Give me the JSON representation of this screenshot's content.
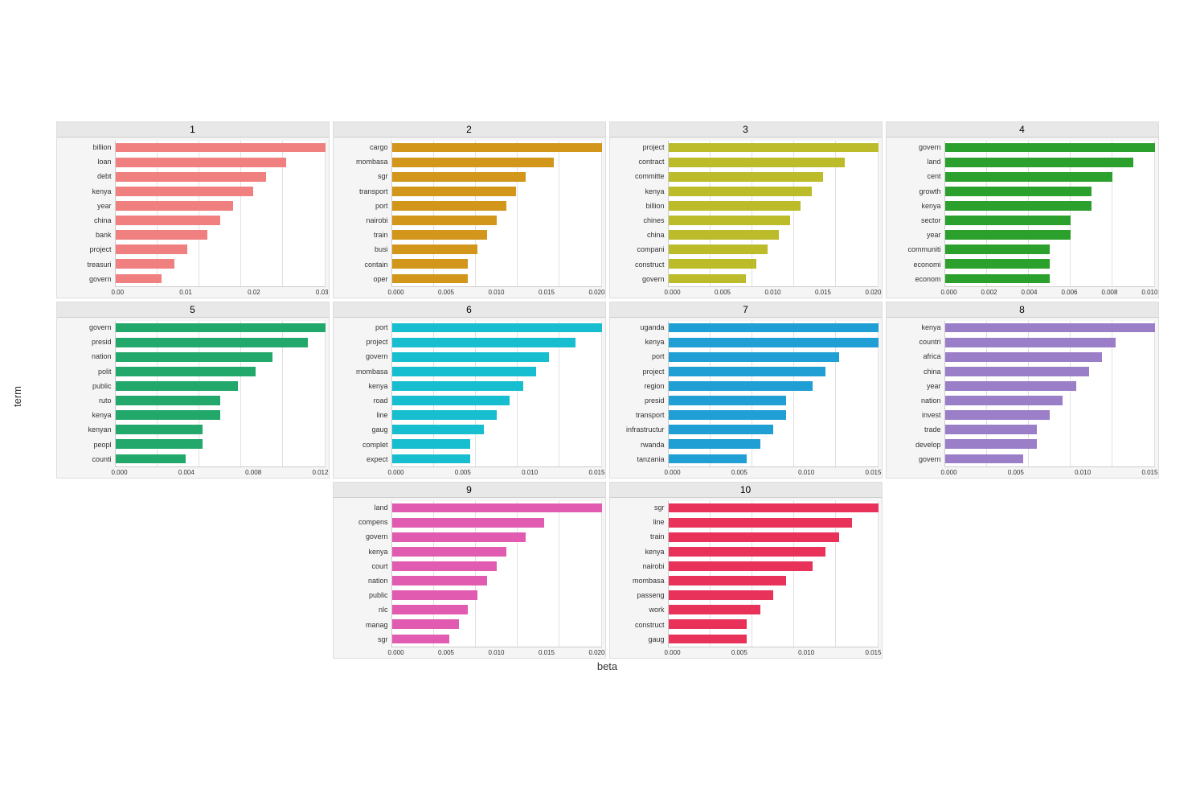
{
  "yAxisLabel": "term",
  "xAxisLabel": "beta",
  "panels": [
    {
      "id": 1,
      "color": "#F08080",
      "maxBeta": 0.03,
      "xLabels": "0.00 0.01 0.02 0.03",
      "terms": [
        {
          "label": "billion",
          "value": 0.032
        },
        {
          "label": "loan",
          "value": 0.026
        },
        {
          "label": "debt",
          "value": 0.023
        },
        {
          "label": "kenya",
          "value": 0.021
        },
        {
          "label": "year",
          "value": 0.018
        },
        {
          "label": "china",
          "value": 0.016
        },
        {
          "label": "bank",
          "value": 0.014
        },
        {
          "label": "project",
          "value": 0.011
        },
        {
          "label": "treasuri",
          "value": 0.009
        },
        {
          "label": "govern",
          "value": 0.007
        }
      ]
    },
    {
      "id": 2,
      "color": "#D2961A",
      "maxBeta": 0.02,
      "xLabels": "0.000 0.005 0.010 0.015 0.020",
      "terms": [
        {
          "label": "cargo",
          "value": 0.022
        },
        {
          "label": "mombasa",
          "value": 0.017
        },
        {
          "label": "sgr",
          "value": 0.014
        },
        {
          "label": "transport",
          "value": 0.013
        },
        {
          "label": "port",
          "value": 0.012
        },
        {
          "label": "nairobi",
          "value": 0.011
        },
        {
          "label": "train",
          "value": 0.01
        },
        {
          "label": "busi",
          "value": 0.009
        },
        {
          "label": "contain",
          "value": 0.008
        },
        {
          "label": "oper",
          "value": 0.008
        }
      ]
    },
    {
      "id": 3,
      "color": "#BCBC2A",
      "maxBeta": 0.02,
      "xLabels": "0.000 0.005 0.010 0.015 0.020",
      "terms": [
        {
          "label": "project",
          "value": 0.019
        },
        {
          "label": "contract",
          "value": 0.016
        },
        {
          "label": "committe",
          "value": 0.014
        },
        {
          "label": "kenya",
          "value": 0.013
        },
        {
          "label": "billion",
          "value": 0.012
        },
        {
          "label": "chines",
          "value": 0.011
        },
        {
          "label": "china",
          "value": 0.01
        },
        {
          "label": "compani",
          "value": 0.009
        },
        {
          "label": "construct",
          "value": 0.008
        },
        {
          "label": "govern",
          "value": 0.007
        }
      ]
    },
    {
      "id": 4,
      "color": "#2CA02C",
      "maxBeta": 0.01,
      "xLabels": "0.000 0.002 0.004 0.006 0.008 0.010",
      "terms": [
        {
          "label": "govern",
          "value": 0.01
        },
        {
          "label": "land",
          "value": 0.009
        },
        {
          "label": "cent",
          "value": 0.008
        },
        {
          "label": "growth",
          "value": 0.007
        },
        {
          "label": "kenya",
          "value": 0.007
        },
        {
          "label": "sector",
          "value": 0.006
        },
        {
          "label": "year",
          "value": 0.006
        },
        {
          "label": "communiti",
          "value": 0.005
        },
        {
          "label": "economi",
          "value": 0.005
        },
        {
          "label": "econom",
          "value": 0.005
        }
      ]
    },
    {
      "id": 5,
      "color": "#22A86A",
      "maxBeta": 0.012,
      "xLabels": "0.000 0.004 0.008 0.012",
      "terms": [
        {
          "label": "govern",
          "value": 0.012
        },
        {
          "label": "presid",
          "value": 0.011
        },
        {
          "label": "nation",
          "value": 0.009
        },
        {
          "label": "polit",
          "value": 0.008
        },
        {
          "label": "public",
          "value": 0.007
        },
        {
          "label": "ruto",
          "value": 0.006
        },
        {
          "label": "kenya",
          "value": 0.006
        },
        {
          "label": "kenyan",
          "value": 0.005
        },
        {
          "label": "peopl",
          "value": 0.005
        },
        {
          "label": "counti",
          "value": 0.004
        }
      ]
    },
    {
      "id": 6,
      "color": "#17BECF",
      "maxBeta": 0.015,
      "xLabels": "0.000 0.005 0.010 0.015",
      "terms": [
        {
          "label": "port",
          "value": 0.016
        },
        {
          "label": "project",
          "value": 0.014
        },
        {
          "label": "govern",
          "value": 0.012
        },
        {
          "label": "mombasa",
          "value": 0.011
        },
        {
          "label": "kenya",
          "value": 0.01
        },
        {
          "label": "road",
          "value": 0.009
        },
        {
          "label": "line",
          "value": 0.008
        },
        {
          "label": "gaug",
          "value": 0.007
        },
        {
          "label": "complet",
          "value": 0.006
        },
        {
          "label": "expect",
          "value": 0.006
        }
      ]
    },
    {
      "id": 7,
      "color": "#1F9FD4",
      "maxBeta": 0.015,
      "xLabels": "0.000 0.005 0.010 0.015",
      "terms": [
        {
          "label": "uganda",
          "value": 0.016
        },
        {
          "label": "kenya",
          "value": 0.016
        },
        {
          "label": "port",
          "value": 0.013
        },
        {
          "label": "project",
          "value": 0.012
        },
        {
          "label": "region",
          "value": 0.011
        },
        {
          "label": "presid",
          "value": 0.009
        },
        {
          "label": "transport",
          "value": 0.009
        },
        {
          "label": "infrastructur",
          "value": 0.008
        },
        {
          "label": "rwanda",
          "value": 0.007
        },
        {
          "label": "tanzania",
          "value": 0.006
        }
      ]
    },
    {
      "id": 8,
      "color": "#9B7EC8",
      "maxBeta": 0.015,
      "xLabels": "0.000 0.005 0.010 0.015",
      "terms": [
        {
          "label": "kenya",
          "value": 0.016
        },
        {
          "label": "countri",
          "value": 0.013
        },
        {
          "label": "africa",
          "value": 0.012
        },
        {
          "label": "china",
          "value": 0.011
        },
        {
          "label": "year",
          "value": 0.01
        },
        {
          "label": "nation",
          "value": 0.009
        },
        {
          "label": "invest",
          "value": 0.008
        },
        {
          "label": "trade",
          "value": 0.007
        },
        {
          "label": "develop",
          "value": 0.007
        },
        {
          "label": "govern",
          "value": 0.006
        }
      ]
    },
    {
      "id": 9,
      "color": "#E15CB0",
      "maxBeta": 0.02,
      "xLabels": "0.000 0.005 0.010 0.015 0.020",
      "terms": [
        {
          "label": "land",
          "value": 0.022
        },
        {
          "label": "compens",
          "value": 0.016
        },
        {
          "label": "govern",
          "value": 0.014
        },
        {
          "label": "kenya",
          "value": 0.012
        },
        {
          "label": "court",
          "value": 0.011
        },
        {
          "label": "nation",
          "value": 0.01
        },
        {
          "label": "public",
          "value": 0.009
        },
        {
          "label": "nlc",
          "value": 0.008
        },
        {
          "label": "manag",
          "value": 0.007
        },
        {
          "label": "sgr",
          "value": 0.006
        }
      ]
    },
    {
      "id": 10,
      "color": "#E8325A",
      "maxBeta": 0.015,
      "xLabels": "0.000 0.005 0.010 0.015",
      "terms": [
        {
          "label": "sgr",
          "value": 0.016
        },
        {
          "label": "line",
          "value": 0.014
        },
        {
          "label": "train",
          "value": 0.013
        },
        {
          "label": "kenya",
          "value": 0.012
        },
        {
          "label": "nairobi",
          "value": 0.011
        },
        {
          "label": "mombasa",
          "value": 0.009
        },
        {
          "label": "passeng",
          "value": 0.008
        },
        {
          "label": "work",
          "value": 0.007
        },
        {
          "label": "construct",
          "value": 0.006
        },
        {
          "label": "gaug",
          "value": 0.006
        }
      ]
    }
  ]
}
